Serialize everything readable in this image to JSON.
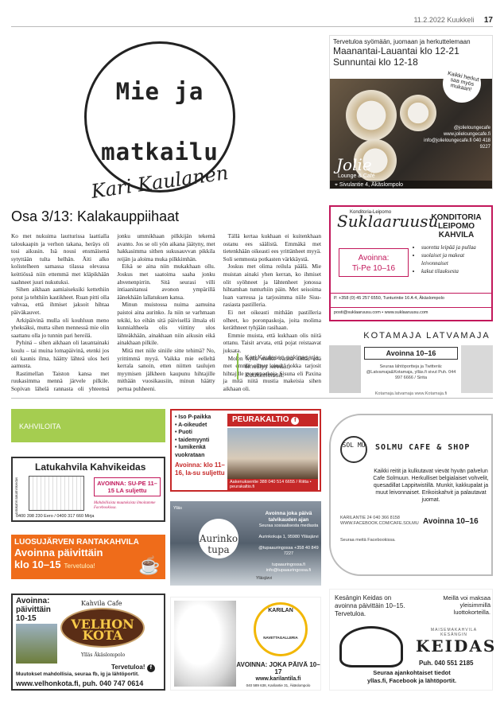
{
  "header": {
    "date_section": "11.2.2022 Kuukkeli",
    "page_number": "17"
  },
  "column_logo": {
    "line1": "Mie ja",
    "line2": "matkailu",
    "author": "Kari Kaulanen"
  },
  "jolie_ad": {
    "tagline": "Tervetuloa syömään, juomaan ja herkuttelemaan",
    "hours1": "Maanantai-Lauantai klo 12-21",
    "hours2": "Sunnuntai klo 12-18",
    "bubble": "Kaikki herkut saa myös mukaan!",
    "social": "@jolieloungecafe www.jolieloungecafe.fi info@jolieloungecafe.fi 040 418 9227",
    "brand": "Jolie",
    "brand_sub": "Lounge & Café",
    "address": "Sivulantie 4, Äkäslompolo"
  },
  "article": {
    "headline": "Osa 3/13: Kalakauppiihaat",
    "paragraphs": [
      "Ko met nukuima lautturissa laattialla taloukaapin ja verhon takana, heräys oli tosi aikusin. Isä nousi ensmäisenä sytyttään tulta helhän. Äiti alko kolistelheen samassa tilassa olevassa keittiössä niin ettemmä met kläpikhään saahneet juuri nukutuksi.",
      "Sihen aikhaan aamiaiseksiki kettethiin potut ja tehthiin kastikheet. Ruan pitti olla vahvaa, että ihmiset jaksoit hihtaa päiväkauvet.",
      "Arkipäivinä mulla oli kouhluun meno yheksäksi, mutta sihen mennessä mie olin saattanu olla jo tunnin pari hereilä.",
      "Pyhinä – sihen aikhaan oli lauantainaki koulu – tai muina lomapäivinä, etenki jos oli kaunis ilma, häätty lähteä ulos heti aamusta.",
      "Rastimellan Taiston kansa met ruukasimma mennä järvele pilkile. Sopivan lähelä rannasta oli yhteensä jonku ummikhaan pilkkijän tekemä avanto. Jos se oli yön aikana jäätyny, met hakkasimma sithen sukusauvvan pikkila reijän ja aloima muka pilkkimhän.",
      "Eikä se aina niin mukakhaan ollu. Joskus met saatoima saaha jonku ahvenenpirrin. Sitä seurasi villi intiaanitanssi avonon ympärillä äänekhään lallatuksen kansa.",
      "Minun muistossa nuima aamuina paistoi aina aurinko. Ja niin se varhmaan tekiki, ko eihän sitä päivisellä ilmala eli kunnialtheela olis viittiny ulos lähteäkhään, ainakhaan niin aikusin eikä ainakhaan pilkile.",
      "Mitä met niile siniile sitte tehimä? No, yrittimmä myyä. Vaikka mie eelleltä kerrala sanoin, etten niitten taulujen myymisen jälkheen kaupunu hihtajille mithään vuosikausiin, minun häätty pertua puhheeni.",
      "Tällä kertaa kukhaan ei kuitenkhaan ostanu ees säälistä. Emmäkä met tietenkhään oikeasti ees yrittänheet myyä. Soli semmosta potkasten värkkäystä.",
      "Joskus met olima reilula päälä. Mie muistan ainaki yhen kerran, ko ihmiset olit syöhneet ja lähtenheet jonossa hihtamhan tunturhiin päin. Met seisoima luan varressa ja tarjosimma niile Sisu-rasiasta pastilleria.",
      "Ei net oikeasti mithään pastilleria olheet, ko poronpaskoja, joita molima keräthneet tyhjään rasihaan.",
      "Emmie muista, että kukhaan olis niitä ottanu. Taisit arvata, että pojat reistaavat juksata.",
      "Molen kyllä melko varma siittä, että met emmä olheet ainut, jokka tarjosit hihtajille poronpaskoja Sisuna eli Paxina ja mitä niitä mustia makeisia sihen aikhaan oli."
    ],
    "note": "Kari Kaulasen pakinasarja ilmestyy kevään Kuukkeleissa."
  },
  "suklaa_ad": {
    "logo_small": "Konditoria-Leipomo",
    "logo": "Suklaaruusu",
    "title": "KONDITORIA LEIPOMO KAHVILA",
    "open_label": "Avoinna:",
    "open_hours": "Ti-Pe 10–16",
    "items": [
      "suoretta leipää ja pullaa",
      "suolaiset ja makeat leivonnaiset",
      "kakut tilauksesta"
    ],
    "contact": "P. +358 (0) 45 257 6550, Tunturintie 16 A 4, Äkäslompolo",
    "web": "posti@suklaaruusu.com • www.suklaaruusu.com"
  },
  "kota_ad": {
    "title": "KOTAMAJA LATVAMAJA",
    "open": "Avoinna 10–16",
    "info": "Seuraa lähtöportteja ja Twitteriä: @Latvamaja&Kotamaja, ylläs.fi sivut Puh. 044 997 6666 / Sirita",
    "foot": "Kotamaja.latvamaja www.Kotamaja.fi"
  },
  "kahviloita": {
    "label": "KAHVILOITA"
  },
  "latu_ad": {
    "title": "Latukahvila Kahvikeidas",
    "side": "latukahvilakahvikeidas",
    "open": "AVOINNA: SU-PE 11–15 LA suljettu",
    "small": "Mahdollisista muutoksista ilmoitamme Facebookissa.",
    "phones": "0400 398 230 Eero / 0400 317 660 Mirja"
  },
  "luos_ad": {
    "title": "LUOSUJÄRVEN RANTAKAHVILA",
    "line1": "Avoinna päivittäin",
    "line2": "klo 10–15",
    "welcome": "Tervetuloa!",
    "cup_icon": "☕"
  },
  "velhon_ad": {
    "open": "Avoinna: päivittäin 10-15",
    "kahvila": "Kahvila Cafe",
    "brand": "VELHON KOTA",
    "place": "Ylläs Äkäslompolo",
    "welcome": "Tervetuloa!",
    "changes": "Muutokset mahdollisia, seuraa fb, ig ja lähtöportit.",
    "web": "www.velhonkota.fi, puh. 040 747 0614"
  },
  "peura_ad": {
    "items": [
      "• Iso P-paikka",
      "• A-oikeudet",
      "• Puoti",
      "• taidemyynti",
      "• lumikenkä vuokrataan"
    ],
    "title": "PEURAKALTIO",
    "open": "Avoinna: klo 11–16, la-su suljettu",
    "footer": "Aakenuksentie 388 040 514 6655 / Riitta • peurakaltio.fi"
  },
  "aurinko_ad": {
    "brand": "Aurinko tupa",
    "open": "Avoinna joka päivä talvikauden ajan",
    "follow": "Seuraa sosiaalisesta mediasta",
    "addr": "Aurinkokuja 1, 95980 Ylläsjärvi",
    "social": "@tupaauringossa +358 40 849 7227",
    "web": "tupaauringossa.fi info@tupaauringossa.fi",
    "place1": "Ylläs",
    "place2": "Ylläsjärvi"
  },
  "karilan_ad": {
    "seal_top": "KARILAN",
    "seal_mid": "NAVETTAGALLERIA",
    "open": "AVOINNA: JOKA PÄIVÄ 10–17",
    "web": "www.karilantila.fi",
    "addr": "040 589 638, Karilantie 31, Äkäslompolo"
  },
  "solmu_ad": {
    "circle": "SOL MU",
    "name": "SOLMU CAFE & SHOP",
    "body": "Kaikki reitit ja kulkutavat vievät hyvän palvelun Cafe Solmuun. Herkulliset belgialaiset vohvelit, quesadillat Lappitwistillä. Munkit, kakkupalat ja muut leivonnaiset. Erikoiskahvit ja palautavat juomat.",
    "addr": "KARILANTIE 24 040 366 8158 WWW.FACEBOOK.COM/CAFE.SOLMU",
    "open": "Avoinna 10–16",
    "fb": "Seuraa meitä Facebookissa."
  },
  "keidas_ad": {
    "left": "Kesängin Keidas on avoinna päivittäin 10–15. Tervetuloa.",
    "right": "Meillä voi maksaa yleisimmillä luottokorteilla.",
    "brand_top": "MAISEMAKAHVILA",
    "brand_mid": "KESÄNGIN",
    "brand": "KEIDAS",
    "phone": "Puh. 040 551 2185",
    "follow1": "Seuraa ajankohtaiset tiedot",
    "follow2": "yllas.fi, Facebook ja lähtöportit."
  }
}
